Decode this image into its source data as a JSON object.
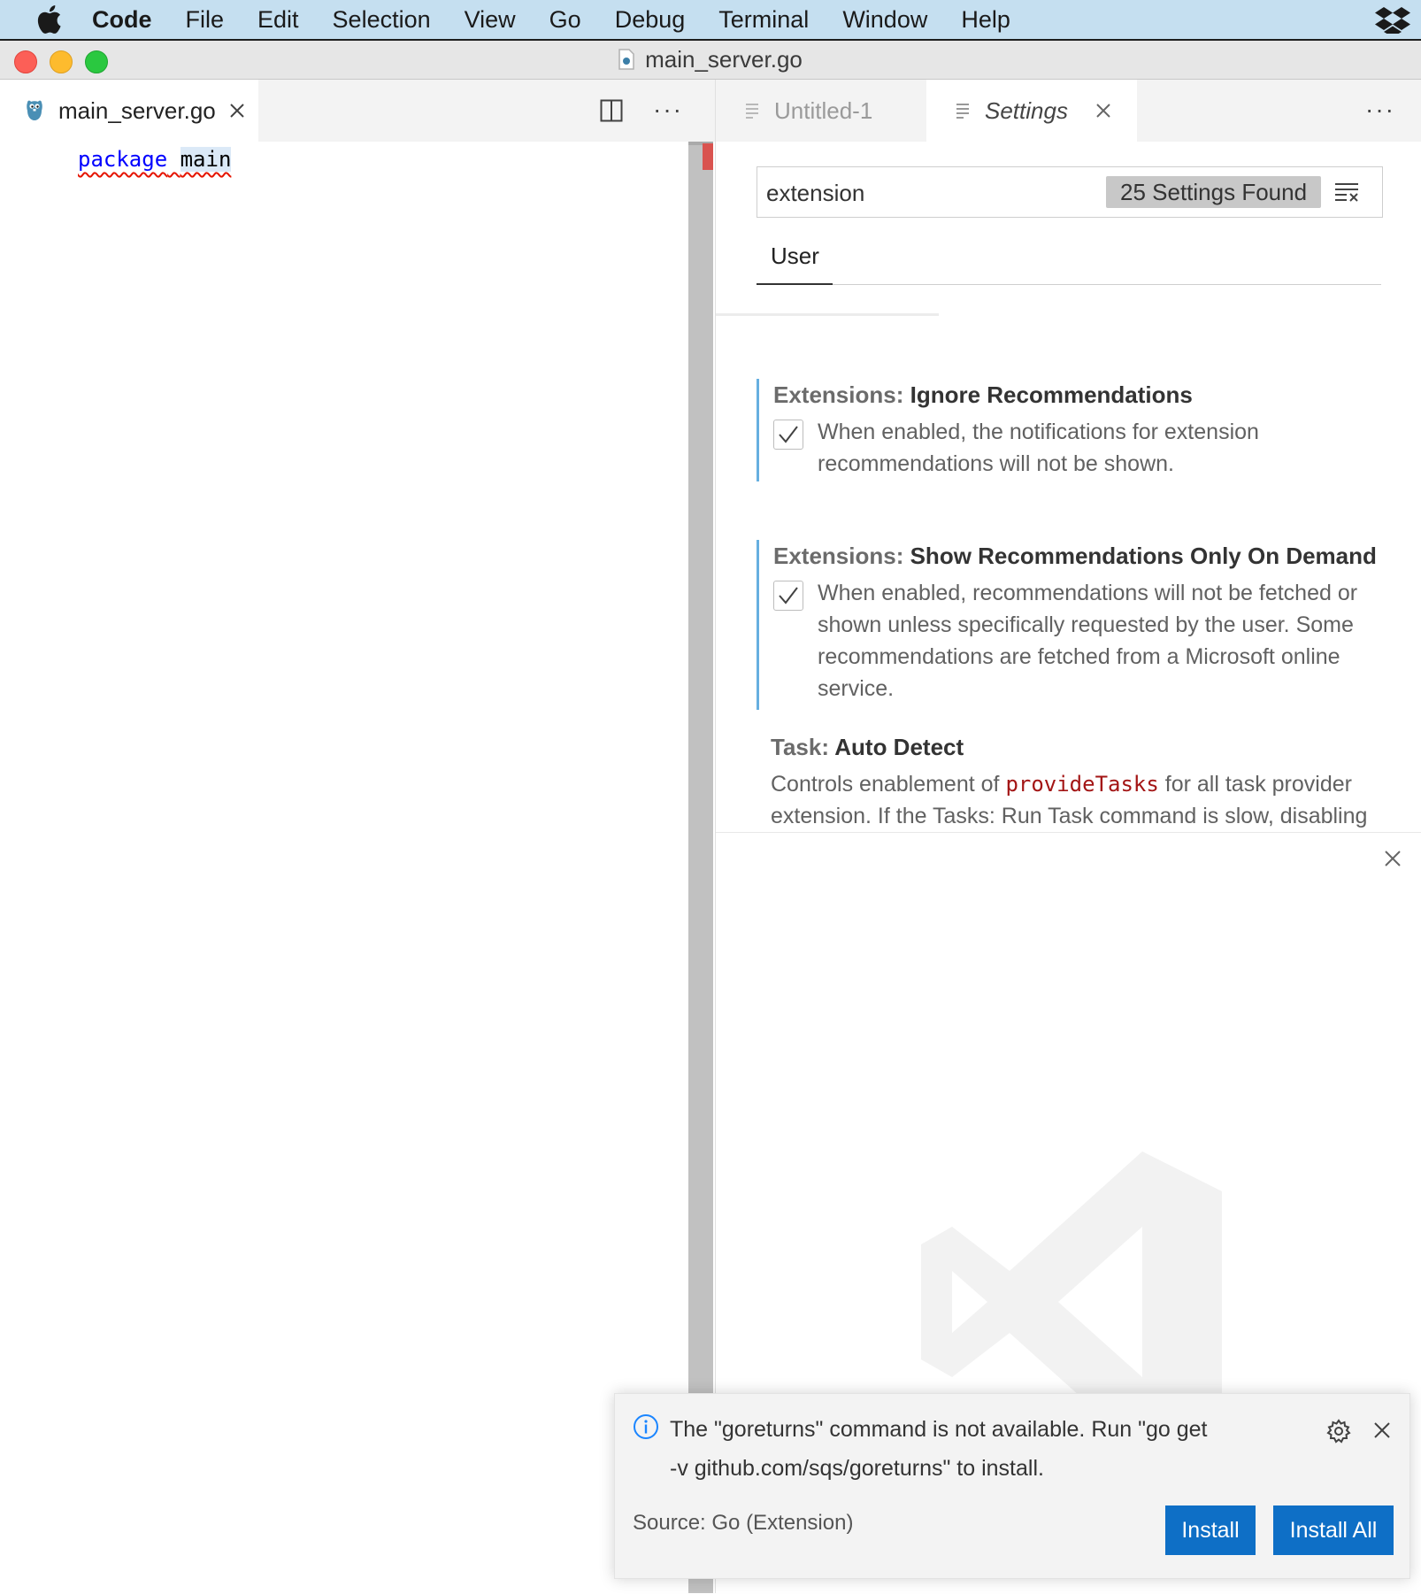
{
  "menubar": {
    "app_name": "Code",
    "items": [
      "File",
      "Edit",
      "Selection",
      "View",
      "Go",
      "Debug",
      "Terminal",
      "Window",
      "Help"
    ]
  },
  "window": {
    "title": "main_server.go"
  },
  "left_editor": {
    "tab_label": "main_server.go",
    "code_keyword": "package",
    "code_identifier": "main"
  },
  "right_editor": {
    "tabs": [
      {
        "label": "Untitled-1",
        "active": false
      },
      {
        "label": "Settings",
        "active": true
      }
    ]
  },
  "settings": {
    "search_value": "extension",
    "found_count": "25 Settings Found",
    "scope_tab": "User",
    "items": [
      {
        "category": "Extensions: ",
        "name": "Ignore Recommendations",
        "checked": true,
        "description": "When enabled, the notifications for extension recommendations will not be shown."
      },
      {
        "category": "Extensions: ",
        "name": "Show Recommendations Only On Demand",
        "checked": true,
        "description": "When enabled, recommendations will not be fetched or shown unless specifically requested by the user. Some recommendations are fetched from a Microsoft online service."
      },
      {
        "category": "Task: ",
        "name": "Auto Detect",
        "description_prefix": "Controls enablement of ",
        "description_code": "provideTasks",
        "description_suffix": " for all task provider extension. If the Tasks: Run Task command is slow, disabling"
      }
    ]
  },
  "notification": {
    "message": "The \"goreturns\" command is not available. Run \"go get -v github.com/sqs/goreturns\" to install.",
    "source": "Source: Go (Extension)",
    "buttons": {
      "install": "Install",
      "install_all": "Install All"
    }
  },
  "colors": {
    "accent_button": "#0e6fc6",
    "modified_indicator": "#66afe0",
    "menubar_bg": "#c5dff0",
    "code_keyword": "#0000ff",
    "code_string": "#a31515",
    "error_squiggle": "#e51400"
  }
}
